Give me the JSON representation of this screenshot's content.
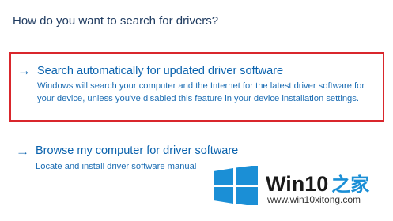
{
  "page": {
    "title": "How do you want to search for drivers?"
  },
  "options": [
    {
      "arrow": "→",
      "title": "Search automatically for updated driver software",
      "description": "Windows will search your computer and the Internet for the latest driver software for your device, unless you've disabled this feature in your device installation settings.",
      "highlighted": true
    },
    {
      "arrow": "→",
      "title": "Browse my computer for driver software",
      "description": "Locate and install driver software manual"
    }
  ],
  "watermark": {
    "logo_icon": "windows-logo-icon",
    "brand_main": "Win10",
    "brand_suffix": "之家",
    "url": "www.win10xitong.com"
  },
  "colors": {
    "link_blue": "#0a62ad",
    "title_navy": "#1e3a5f",
    "highlight_red": "#d9262c",
    "logo_blue": "#1b8fd6"
  }
}
